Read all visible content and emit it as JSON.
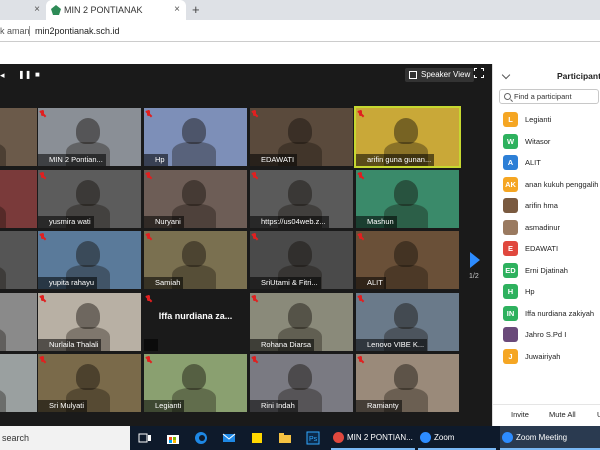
{
  "browser": {
    "tabs": [
      {
        "label": "",
        "close": "×"
      },
      {
        "label": "MIN 2 PONTIANAK",
        "close": "×"
      }
    ],
    "new_tab": "+",
    "address": {
      "security": "k aman",
      "url": "min2pontianak.sch.id"
    }
  },
  "zoom": {
    "speaker_view_label": "Speaker View",
    "page_indicator": "1/2",
    "tiles": [
      {
        "name": "",
        "bg": "#6b5a4a"
      },
      {
        "name": "MIN 2 Pontian...",
        "bg": "#8a8f96"
      },
      {
        "name": "Hp",
        "bg": "#7d8fb8"
      },
      {
        "name": "EDAWATI",
        "bg": "#5a4a3c"
      },
      {
        "name": "arifin guna gunan...",
        "bg": "#c9a838"
      },
      {
        "name": "",
        "bg": "#7a3a3a"
      },
      {
        "name": "yusmira wati",
        "bg": "#5c5c5c"
      },
      {
        "name": "Nuryani",
        "bg": "#6d5d56"
      },
      {
        "name": "https://us04web.z...",
        "bg": "#5a5a5a"
      },
      {
        "name": "Mashun",
        "bg": "#3a8a6a"
      },
      {
        "name": "",
        "bg": "#555"
      },
      {
        "name": "yupita rahayu",
        "bg": "#5a7a9a"
      },
      {
        "name": "Samiah",
        "bg": "#7a7050"
      },
      {
        "name": "SriUtami & Fitri...",
        "bg": "#4a4a4a"
      },
      {
        "name": "ALIT",
        "bg": "#6a5038"
      },
      {
        "name": "",
        "bg": "#8a8a8a"
      },
      {
        "name": "Nurlaila Thalali",
        "bg": "#b8b0a4"
      },
      {
        "name": "",
        "bg": "#1a1a1a",
        "text": "Iffa nurdiana za..."
      },
      {
        "name": "Rohana Diarsa",
        "bg": "#8a8a7a"
      },
      {
        "name": "Lenovo VIBE K...",
        "bg": "#6a7a8a"
      },
      {
        "name": "",
        "bg": "#9aa0a0"
      },
      {
        "name": "Sri Mulyati",
        "bg": "#7a6a4a"
      },
      {
        "name": "Legianti",
        "bg": "#8aa070"
      },
      {
        "name": "Rini Indah",
        "bg": "#7a7a82"
      },
      {
        "name": "Ramianty",
        "bg": "#9a8a7a"
      }
    ]
  },
  "participants": {
    "title": "Participants",
    "search_placeholder": "Find a participant",
    "items": [
      {
        "initials": "L",
        "name": "Legianti",
        "color": "#f5a623"
      },
      {
        "initials": "W",
        "name": "Witasor",
        "color": "#2eb15e"
      },
      {
        "initials": "A",
        "name": "ALIT",
        "color": "#2d7fd6"
      },
      {
        "initials": "AK",
        "name": "anan kukuh penggalih",
        "color": "#f5a623"
      },
      {
        "initials": "",
        "name": "arifin hma",
        "color": "#7a5a40"
      },
      {
        "initials": "",
        "name": "asmadinur",
        "color": "#9a7a60"
      },
      {
        "initials": "E",
        "name": "EDAWATI",
        "color": "#e0483e"
      },
      {
        "initials": "ED",
        "name": "Erni Djatinah",
        "color": "#2eb15e"
      },
      {
        "initials": "H",
        "name": "Hp",
        "color": "#2eb15e"
      },
      {
        "initials": "IN",
        "name": "Iffa nurdiana zakiyah",
        "color": "#2eb15e"
      },
      {
        "initials": "",
        "name": "Jahro S.Pd I",
        "color": "#6a4a7a"
      },
      {
        "initials": "J",
        "name": "Juwairiyah",
        "color": "#f5a623"
      }
    ],
    "invite_label": "Invite",
    "mute_all_label": "Mute All",
    "more_label": "U"
  },
  "taskbar": {
    "search_label": "search",
    "apps": [
      {
        "label": "MIN 2 PONTIAN...",
        "color": "#e0483e"
      },
      {
        "label": "Zoom",
        "color": "#2d8cff"
      },
      {
        "label": "Zoom Meeting",
        "color": "#2d8cff"
      }
    ]
  }
}
